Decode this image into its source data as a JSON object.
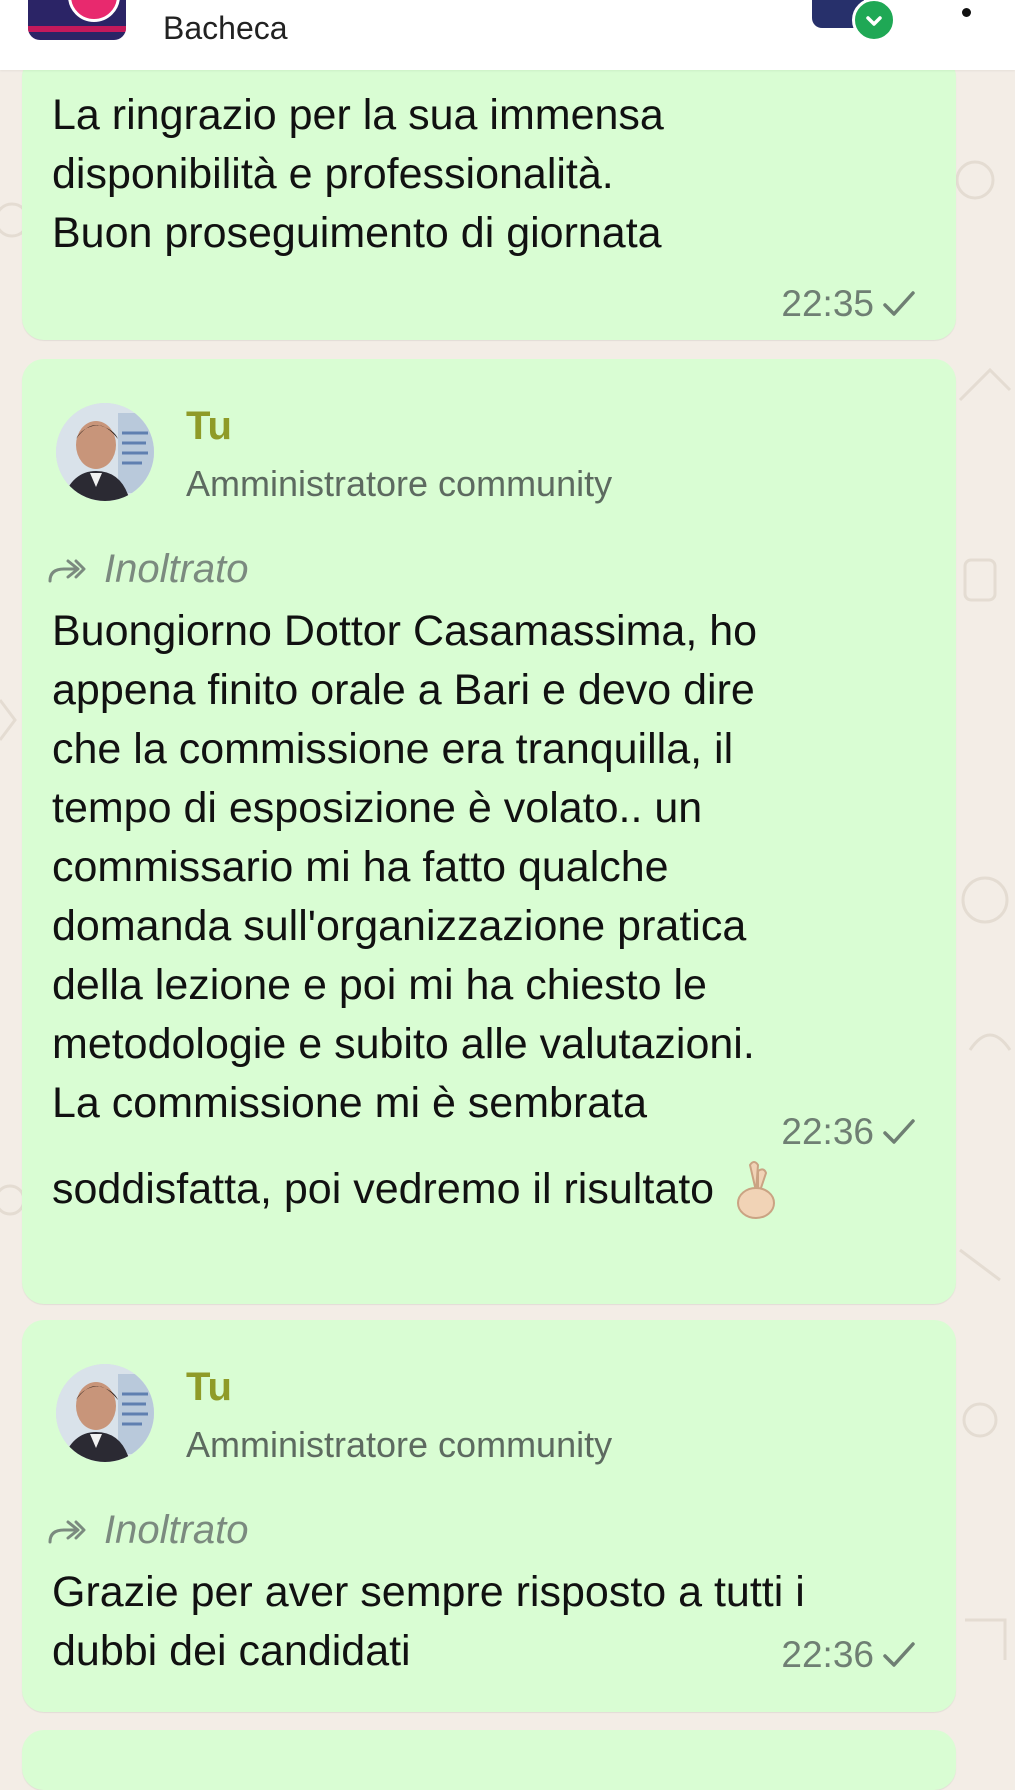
{
  "header": {
    "title": "Bacheca"
  },
  "messages": [
    {
      "text": "La ringrazio per la sua immensa\ndisponibilità e professionalità.\nBuon proseguimento di giornata",
      "time": "22:35"
    },
    {
      "sender": "Tu",
      "role": "Amministratore community",
      "forwarded": "Inoltrato",
      "text": "Buongiorno Dottor Casamassima,  ho\nappena finito orale a Bari e devo dire\nche la commissione era tranquilla,  il\ntempo di esposizione è volato.. un\ncommissario mi ha fatto qualche\ndomanda sull'organizzazione pratica\ndella lezione e poi mi ha chiesto le\nmetodologie e subito alle valutazioni.\nLa commissione mi è sembrata",
      "text_last_line": "soddisfatta, poi vedremo il risultato",
      "emoji": "crossed-fingers",
      "time": "22:36"
    },
    {
      "sender": "Tu",
      "role": "Amministratore community",
      "forwarded": "Inoltrato",
      "text": "Grazie per aver sempre risposto a tutti i\ndubbi dei candidati",
      "time": "22:36"
    }
  ],
  "colors": {
    "bubble": "#d9fdd3",
    "sender_name": "#8f9b28",
    "check_badge": "#1fa855",
    "wallpaper": "#f3ede6"
  }
}
